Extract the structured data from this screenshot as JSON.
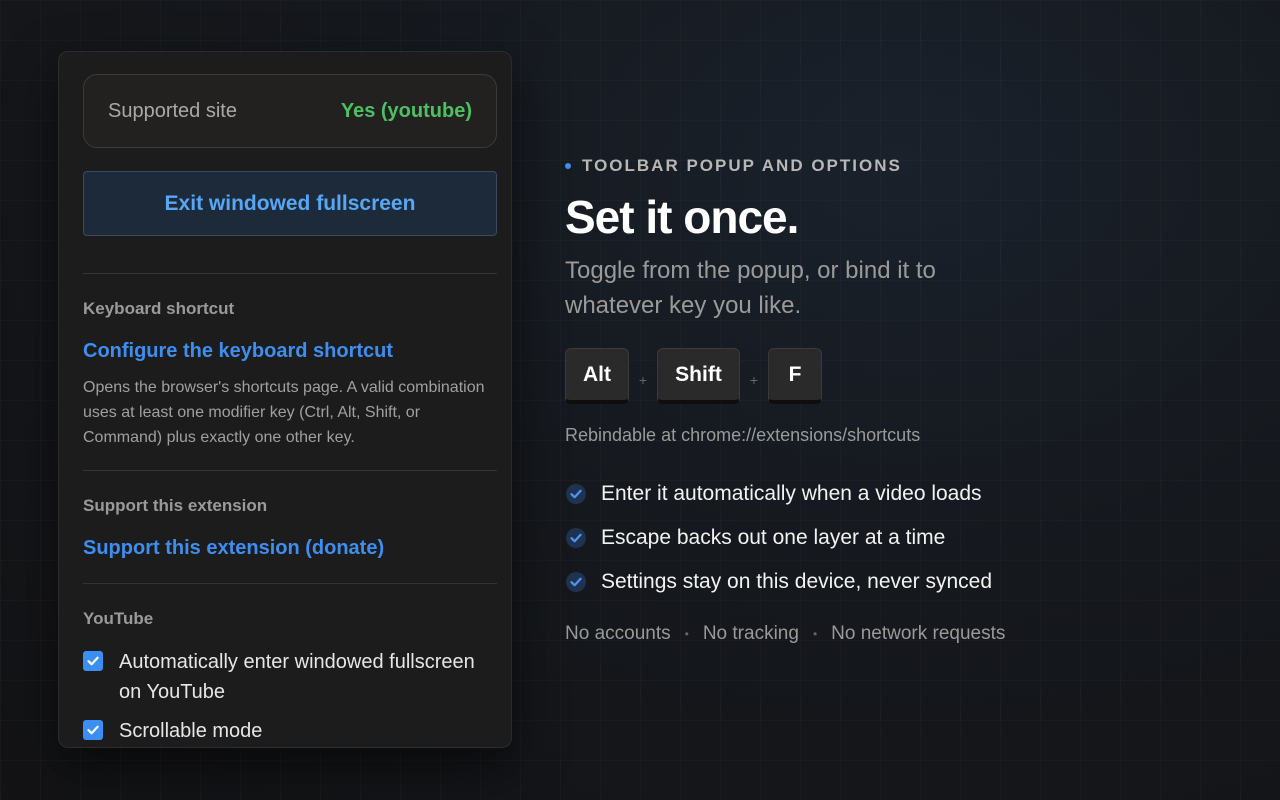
{
  "popup": {
    "site_label": "Supported site",
    "site_value": "Yes (youtube)",
    "exit_button": "Exit windowed fullscreen",
    "shortcut_title": "Keyboard shortcut",
    "shortcut_link": "Configure the keyboard shortcut",
    "shortcut_desc": "Opens the browser's shortcuts page. A valid combination uses at least one modifier key (Ctrl, Alt, Shift, or Command) plus exactly one other key.",
    "support_title": "Support this extension",
    "support_link": "Support this extension (donate)",
    "youtube_title": "YouTube",
    "options": [
      {
        "label": "Automatically enter windowed fullscreen on YouTube",
        "checked": true
      },
      {
        "label": "Scrollable mode",
        "checked": true
      }
    ]
  },
  "hero": {
    "eyebrow": "TOOLBAR POPUP AND OPTIONS",
    "headline": "Set it once.",
    "subhead": "Toggle from the popup, or bind it to whatever key you like.",
    "keys": [
      "Alt",
      "Shift",
      "F"
    ],
    "plus": "+",
    "rebind": "Rebindable at chrome://extensions/shortcuts",
    "features": [
      "Enter it automatically when a video loads",
      "Escape backs out one layer at a time",
      "Settings stay on this device, never synced"
    ],
    "footer": [
      "No accounts",
      "No tracking",
      "No network requests"
    ]
  },
  "colors": {
    "accent": "#3e8ef0",
    "success": "#4cc063",
    "background": "#15181d",
    "panel": "#1c1c1c"
  }
}
